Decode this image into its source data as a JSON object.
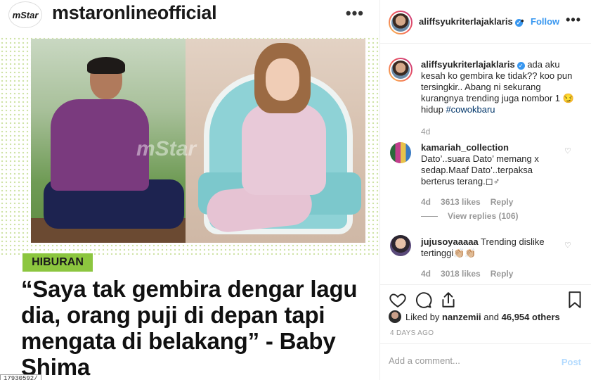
{
  "post": {
    "inner_username": "mstaronlineofficial",
    "inner_logo": "mStar",
    "watermark": "mStar",
    "tag": "HIBURAN",
    "headline": "“Saya tak gembira dengar lagu dia, orang puji di depan tapi mengata di belakang” - Baby Shima",
    "bottom_label": "17930592/"
  },
  "header": {
    "username": "aliffsyukriterlajaklaris",
    "separator": "•",
    "follow_label": "Follow",
    "more_icon": "more-horizontal-icon"
  },
  "caption": {
    "username": "aliffsyukriterlajaklaris",
    "text": "ada aku kesah ko gembira ke tidak?? koo pun tersingkir.. Abang ni sekurang kurangnya trending juga nombor 1 😏 hidup",
    "hashtag": "#cowokbaru",
    "time": "4d"
  },
  "comments": [
    {
      "username": "kamariah_collection",
      "text": "Dato’..suara Dato’ memang x sedap.Maaf Dato’..terpaksa berterus terang.◻♂",
      "time": "4d",
      "likes": "3613 likes",
      "reply": "Reply",
      "view_replies": "View replies (106)"
    },
    {
      "username": "jujusoyaaaaa",
      "text": "Trending dislike tertinggi👏🏼👏🏼",
      "time": "4d",
      "likes": "3018 likes",
      "reply": "Reply"
    }
  ],
  "likes": {
    "prefix": "Liked by",
    "user": "nanzemii",
    "connector": "and",
    "others": "46,954 others"
  },
  "timeago": "4 DAYS AGO",
  "comment_box": {
    "placeholder": "Add a comment...",
    "post_label": "Post"
  },
  "colors": {
    "link_blue": "#3897f0",
    "tag_green": "#8cc63f",
    "muted": "#999999"
  }
}
